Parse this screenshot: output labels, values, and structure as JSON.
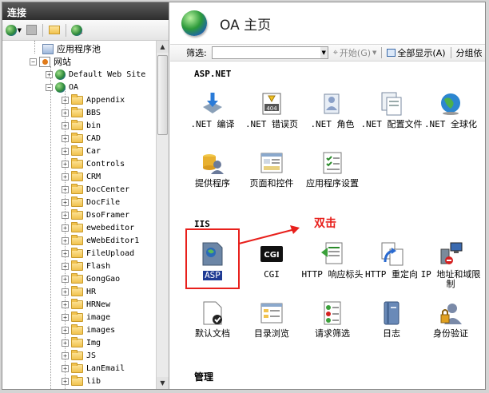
{
  "left_pane": {
    "header": "连接",
    "toolbar": [
      {
        "icon": "connect-globe-icon"
      },
      {
        "icon": "save-icon"
      },
      {
        "icon": "folder-up-icon"
      },
      {
        "icon": "disconnect-icon"
      }
    ],
    "tree": {
      "app_pools": "应用程序池",
      "sites": "网站",
      "default_site": "Default Web Site",
      "oa": "OA",
      "folders": [
        "Appendix",
        "BBS",
        "bin",
        "CAD",
        "Car",
        "Controls",
        "CRM",
        "DocCenter",
        "DocFile",
        "DsoFramer",
        "ewebeditor",
        "eWebEditor1",
        "FileUpload",
        "Flash",
        "GongGao",
        "HR",
        "HRNew",
        "image",
        "images",
        "Img",
        "JS",
        "LanEmail",
        "lib"
      ]
    }
  },
  "right_pane": {
    "title": "OA 主页",
    "filter": {
      "label": "筛选:",
      "go": "开始(G)",
      "show_all": "全部显示(A)",
      "group": "分组依"
    },
    "sections": {
      "aspnet": "ASP.NET",
      "iis": "IIS",
      "manage": "管理"
    },
    "aspnet_features": [
      ".NET 编译",
      ".NET 错误页",
      ".NET 角色",
      ".NET 配置文件",
      ".NET 全球化",
      "提供程序",
      "页面和控件",
      "应用程序设置"
    ],
    "iis_features": [
      "ASP",
      "CGI",
      "HTTP 响应标头",
      "HTTP 重定向",
      "IP 地址和域限制",
      "默认文档",
      "目录浏览",
      "请求筛选",
      "日志",
      "身份验证"
    ],
    "annotation": "双击",
    "icon_texts": {
      "asp": "ASP",
      "cgi": "CGI",
      "error": "404"
    }
  },
  "colors": {
    "annotation": "#e8201c",
    "header_bg": "#3a3a3a"
  }
}
